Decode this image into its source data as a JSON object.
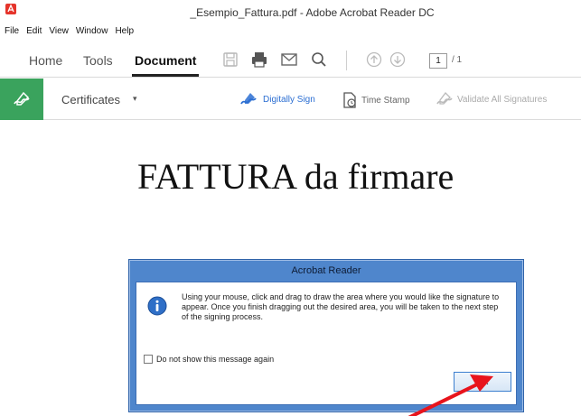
{
  "window": {
    "title": "_Esempio_Fattura.pdf - Adobe Acrobat Reader DC"
  },
  "menu": [
    "File",
    "Edit",
    "View",
    "Window",
    "Help"
  ],
  "toolbar": {
    "tabs": [
      "Home",
      "Tools",
      "Document"
    ],
    "active_tab": "Document",
    "page_current": "1",
    "page_total": "/ 1",
    "icons": [
      "save-icon",
      "print-icon",
      "mail-icon",
      "search-icon",
      "page-up-icon",
      "page-down-icon"
    ]
  },
  "certificates_bar": {
    "label": "Certificates",
    "caret": "▾",
    "actions": {
      "digitally_sign": "Digitally Sign",
      "time_stamp": "Time Stamp",
      "validate_all": "Validate All Signatures"
    },
    "accent_color": "#3aa35d",
    "link_color": "#2b6ed2"
  },
  "document": {
    "heading": "FATTURA da firmare"
  },
  "dialog": {
    "title": "Acrobat Reader",
    "message": "Using your mouse, click and drag to draw the area where you would like the signature to appear. Once you finish dragging out the desired area, you will be taken to the next step of the signing process.",
    "checkbox_label": "Do not show this message again",
    "checkbox_checked": false,
    "ok_label": "OK",
    "frame_color": "#4f86cc"
  },
  "annotation": {
    "arrow_color": "#e8141c"
  }
}
